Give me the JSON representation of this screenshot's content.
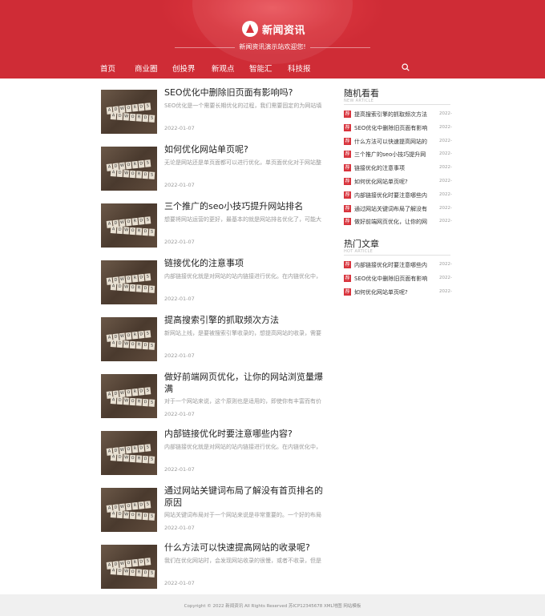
{
  "header": {
    "logo_text": "新闻资讯",
    "slogan": "新闻资讯演示站欢迎您!",
    "nav": [
      "首页",
      "商业圈",
      "创投界",
      "新观点",
      "智能汇",
      "科技报"
    ]
  },
  "thumbnail": {
    "tiles_top": [
      "A",
      "D",
      "W",
      "O",
      "R",
      "D",
      "S"
    ]
  },
  "articles": [
    {
      "title": "SEO优化中删除旧页面有影响吗?",
      "desc": "SEO优化是一个需要长期优化的过程，我们需要固定的为网站填",
      "date": "2022-01-07"
    },
    {
      "title": "如何优化网站单页呢?",
      "desc": "无论是网站还是单页面都可以进行优化，单页面优化对于网站整",
      "date": "2022-01-07"
    },
    {
      "title": "三个推广的seo小技巧提升网站排名",
      "desc": "想要将网站运营的更好，最基本的就是网站排名优化了，可能大",
      "date": "2022-01-07"
    },
    {
      "title": "链接优化的注意事项",
      "desc": "内部链接优化就是对网站的站内链接进行优化。在内链优化中，",
      "date": "2022-01-07"
    },
    {
      "title": "提高搜索引擎的抓取频次方法",
      "desc": "新网站上线，是要被搜索引擎收录的，想提高网站的收录，需要",
      "date": "2022-01-07"
    },
    {
      "title": "做好前端网页优化，让你的网站浏览量爆满",
      "desc": "对于一个网站来说，这个原则也是适用的，即使你有丰富而有价",
      "date": "2022-01-07"
    },
    {
      "title": "内部链接优化时要注意哪些内容?",
      "desc": "内部链接优化就是对网站的站内链接进行优化。在内链优化中，",
      "date": "2022-01-07"
    },
    {
      "title": "通过网站关键词布局了解没有首页排名的原因",
      "desc": "网站关键词布局对于一个网站来说是非常重要的。一个好的布局",
      "date": "2022-01-07"
    },
    {
      "title": "什么方法可以快速提高网站的收录呢?",
      "desc": "我们在优化网站时，会发现网站收录的很慢，或者不收录，但是",
      "date": "2022-01-07"
    }
  ],
  "sidebar": {
    "random": {
      "title": "随机看看",
      "sub": "NEW ARTICLE",
      "items": [
        {
          "icon": "荐",
          "text": "提高搜索引擎的抓取频次方法",
          "date": "2022-"
        },
        {
          "icon": "荐",
          "text": "SEO优化中删除旧页面有影响",
          "date": "2022-"
        },
        {
          "icon": "荐",
          "text": "什么方法可以快速提高网站的",
          "date": "2022-"
        },
        {
          "icon": "荐",
          "text": "三个推广的seo小技巧提升网",
          "date": "2022-"
        },
        {
          "icon": "荐",
          "text": "链接优化的注意事项",
          "date": "2022-"
        },
        {
          "icon": "荐",
          "text": "如何优化网站单页呢?",
          "date": "2022-"
        },
        {
          "icon": "荐",
          "text": "内部链接优化时要注意哪些内",
          "date": "2022-"
        },
        {
          "icon": "荐",
          "text": "通过网站关键词布局了解没有",
          "date": "2022-"
        },
        {
          "icon": "荐",
          "text": "做好前端网页优化，让你的网",
          "date": "2022-"
        }
      ]
    },
    "hot": {
      "title": "热门文章",
      "sub": "HOT ARTICLE",
      "items": [
        {
          "icon": "荐",
          "text": "内部链接优化时要注意哪些内",
          "date": "2022-"
        },
        {
          "icon": "荐",
          "text": "SEO优化中删除旧页面有影响",
          "date": "2022-"
        },
        {
          "icon": "荐",
          "text": "如何优化网站单页呢?",
          "date": "2022-"
        }
      ]
    }
  },
  "footer": {
    "text": "Copyright © 2022 新闻资讯 All Rights Reserved   苏ICP12345678   XML地图   网站模板"
  },
  "colors": {
    "brand": "#d8333c",
    "footer_bg": "#f0f0f0"
  },
  "icons": {
    "search": "search-icon",
    "logo": "logo-icon"
  }
}
